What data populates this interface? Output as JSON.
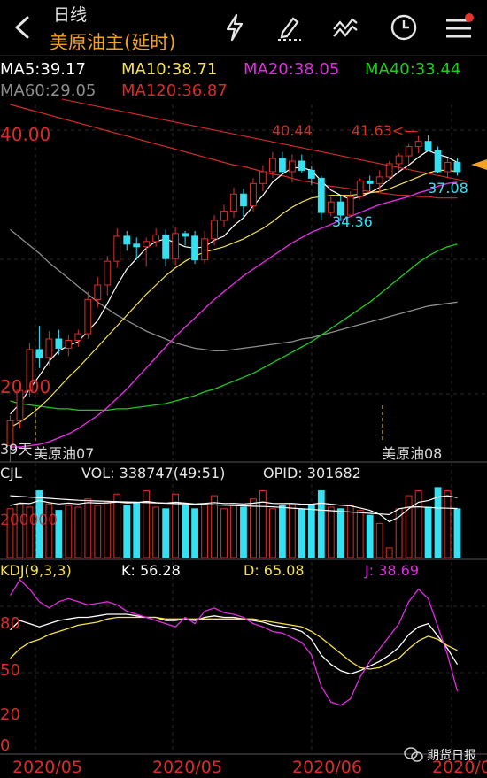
{
  "header": {
    "period": "日线",
    "instrument": "美原油主(延时)",
    "icons": [
      "back-arrow-icon",
      "lightning-icon",
      "pen-draw-icon",
      "indicator-icon",
      "clock-icon",
      "menu-list-icon"
    ]
  },
  "ma_legend": {
    "ma5": "MA5:39.17",
    "ma10": "MA10:38.71",
    "ma20": "MA20:38.05",
    "ma40": "MA40:33.44",
    "ma60": "MA60:29.05",
    "ma120": "MA120:36.87"
  },
  "colors": {
    "up": "#d9302c",
    "down": "#34e1f2",
    "ma5": "#ffffff",
    "ma10": "#f5e14b",
    "ma20": "#e02de0",
    "ma40": "#1ecb1e",
    "ma60": "#8e8e8e",
    "ma120": "#d92b2b",
    "accent": "#f0a126"
  },
  "price_panel": {
    "price_high_label": "40.00",
    "price_low_label": "20.00",
    "high_mark_1": "40.44",
    "high_mark_2": "41.63<—",
    "low_mark": "34.36",
    "recent_low": "37.08",
    "days_label": "39天",
    "contract_1": "美原油07",
    "contract_2": "美原油08"
  },
  "volume_panel": {
    "title": "CJL",
    "vol": "VOL: 338747(49:51)",
    "opid": "OPID: 301682",
    "axis_label": "200000"
  },
  "kdj_panel": {
    "title": "KDJ(9,3,3)",
    "k": "K: 56.28",
    "d": "D: 65.08",
    "j": "J: 38.69",
    "ticks": [
      "80",
      "50",
      "20",
      "0"
    ]
  },
  "x_axis": [
    "2020/05",
    "2020/05",
    "2020/06",
    "2020/0"
  ],
  "watermark": "期货日报",
  "chart_data": [
    {
      "type": "candlestick",
      "title": "美原油主(延时)",
      "ylim": [
        17,
        44
      ],
      "candles": [
        [
          18.1,
          20.4,
          16.9,
          20.0
        ],
        [
          20.0,
          22.8,
          19.4,
          22.3
        ],
        [
          22.3,
          25.9,
          21.8,
          25.4
        ],
        [
          25.4,
          27.2,
          24.0,
          24.8
        ],
        [
          24.8,
          26.8,
          24.2,
          26.2
        ],
        [
          26.2,
          26.9,
          25.0,
          25.5
        ],
        [
          25.5,
          26.5,
          24.9,
          26.1
        ],
        [
          26.1,
          26.9,
          25.6,
          26.6
        ],
        [
          26.6,
          29.8,
          26.2,
          29.2
        ],
        [
          29.2,
          30.9,
          28.6,
          30.3
        ],
        [
          30.3,
          32.5,
          29.5,
          32.1
        ],
        [
          32.1,
          34.6,
          31.6,
          34.0
        ],
        [
          34.0,
          34.4,
          32.9,
          33.4
        ],
        [
          33.4,
          33.9,
          32.2,
          33.2
        ],
        [
          33.2,
          33.9,
          31.7,
          33.6
        ],
        [
          33.6,
          34.6,
          33.2,
          34.1
        ],
        [
          34.1,
          34.5,
          31.7,
          32.3
        ],
        [
          32.3,
          34.7,
          31.8,
          34.2
        ],
        [
          34.2,
          34.4,
          33.3,
          34.0
        ],
        [
          34.0,
          34.4,
          31.9,
          32.2
        ],
        [
          32.2,
          34.4,
          31.9,
          33.8
        ],
        [
          33.8,
          35.6,
          33.3,
          35.2
        ],
        [
          35.2,
          36.4,
          34.7,
          35.9
        ],
        [
          35.9,
          37.7,
          35.4,
          37.2
        ],
        [
          37.2,
          37.6,
          35.4,
          36.3
        ],
        [
          36.3,
          38.4,
          35.9,
          38.0
        ],
        [
          38.0,
          39.4,
          37.4,
          38.9
        ],
        [
          38.9,
          40.4,
          38.4,
          39.9
        ],
        [
          39.9,
          40.4,
          38.7,
          38.9
        ],
        [
          38.9,
          40.2,
          38.1,
          39.7
        ],
        [
          39.7,
          40.2,
          38.8,
          39.0
        ],
        [
          39.0,
          39.3,
          37.9,
          38.4
        ],
        [
          38.4,
          38.6,
          35.2,
          35.8
        ],
        [
          35.8,
          37.0,
          35.5,
          36.6
        ],
        [
          36.6,
          37.1,
          35.2,
          35.6
        ],
        [
          35.6,
          37.4,
          35.5,
          37.0
        ],
        [
          37.0,
          38.4,
          36.8,
          38.2
        ],
        [
          38.2,
          38.6,
          37.4,
          38.0
        ],
        [
          38.0,
          39.0,
          37.3,
          38.5
        ],
        [
          38.5,
          39.7,
          38.2,
          39.5
        ],
        [
          39.5,
          40.3,
          39.0,
          40.1
        ],
        [
          40.1,
          41.0,
          39.5,
          40.8
        ],
        [
          40.8,
          41.6,
          40.3,
          41.2
        ],
        [
          41.2,
          41.7,
          40.6,
          40.5
        ],
        [
          40.5,
          40.8,
          38.8,
          38.9
        ],
        [
          38.9,
          39.9,
          38.4,
          39.6
        ],
        [
          39.6,
          39.9,
          38.6,
          38.9
        ]
      ],
      "ma5": [
        20.5,
        21.3,
        22.4,
        23.4,
        24.5,
        25.3,
        25.7,
        26.0,
        26.8,
        27.6,
        28.9,
        30.3,
        31.5,
        32.3,
        33.1,
        33.6,
        33.8,
        33.5,
        33.2,
        33.1,
        33.2,
        33.7,
        34.0,
        34.8,
        35.4,
        36.3,
        37.1,
        38.1,
        38.7,
        39.2,
        39.2,
        39.0,
        38.2,
        37.5,
        37.1,
        36.8,
        37.0,
        37.3,
        37.7,
        38.3,
        38.9,
        39.4,
        40.0,
        40.5,
        40.2,
        40.0,
        39.6
      ],
      "ma10": [
        19.5,
        19.9,
        20.4,
        21.0,
        21.7,
        22.5,
        23.3,
        24.0,
        24.8,
        25.6,
        26.4,
        27.2,
        28.0,
        28.8,
        29.6,
        30.3,
        31.0,
        31.6,
        32.1,
        32.5,
        32.8,
        33.0,
        33.2,
        33.5,
        33.8,
        34.2,
        34.6,
        35.1,
        35.7,
        36.2,
        36.6,
        36.9,
        37.0,
        37.1,
        37.1,
        37.1,
        37.2,
        37.3,
        37.4,
        37.6,
        37.9,
        38.2,
        38.5,
        38.8,
        39.0,
        39.0,
        38.9
      ],
      "ma20": [
        18.0,
        18.0,
        18.1,
        18.2,
        18.4,
        18.7,
        19.0,
        19.4,
        19.9,
        20.4,
        21.0,
        21.7,
        22.4,
        23.2,
        24.0,
        24.8,
        25.6,
        26.4,
        27.1,
        27.8,
        28.5,
        29.2,
        29.8,
        30.4,
        31.0,
        31.5,
        32.0,
        32.5,
        33.0,
        33.5,
        33.9,
        34.3,
        34.6,
        34.9,
        35.2,
        35.5,
        35.8,
        36.1,
        36.4,
        36.6,
        36.8,
        37.0,
        37.3,
        37.5,
        37.8,
        38.0,
        38.1
      ],
      "ma40": [
        21.5,
        21.3,
        21.2,
        21.1,
        21.0,
        20.9,
        20.9,
        20.8,
        20.8,
        20.8,
        20.8,
        20.9,
        20.9,
        21.0,
        21.1,
        21.2,
        21.3,
        21.5,
        21.7,
        21.9,
        22.2,
        22.4,
        22.7,
        23.0,
        23.3,
        23.6,
        24.0,
        24.4,
        24.8,
        25.2,
        25.6,
        26.0,
        26.5,
        27.0,
        27.5,
        28.0,
        28.5,
        29.0,
        29.6,
        30.2,
        30.8,
        31.4,
        32.0,
        32.5,
        32.9,
        33.2,
        33.4
      ],
      "ma60": [
        34.5,
        33.9,
        33.3,
        32.7,
        32.0,
        31.4,
        30.8,
        30.2,
        29.6,
        29.0,
        28.5,
        28.0,
        27.6,
        27.2,
        26.8,
        26.5,
        26.2,
        25.9,
        25.7,
        25.5,
        25.4,
        25.3,
        25.3,
        25.4,
        25.5,
        25.6,
        25.7,
        25.8,
        25.9,
        26.0,
        26.2,
        26.3,
        26.5,
        26.7,
        26.9,
        27.1,
        27.3,
        27.5,
        27.7,
        27.9,
        28.1,
        28.3,
        28.5,
        28.7,
        28.8,
        28.9,
        29.0
      ],
      "ma120": [
        44.0,
        43.8,
        43.6,
        43.4,
        43.2,
        43.0,
        42.8,
        42.6,
        42.4,
        42.2,
        42.0,
        41.8,
        41.6,
        41.4,
        41.2,
        41.0,
        40.8,
        40.6,
        40.4,
        40.2,
        40.0,
        39.8,
        39.6,
        39.4,
        39.3,
        39.1,
        38.9,
        38.7,
        38.6,
        38.4,
        38.2,
        38.1,
        37.9,
        37.8,
        37.7,
        37.6,
        37.5,
        37.4,
        37.3,
        37.2,
        37.1,
        37.1,
        37.0,
        37.0,
        36.9,
        36.9,
        36.9
      ]
    },
    {
      "type": "bar",
      "title": "CJL",
      "ylim": [
        0,
        500000
      ],
      "volumes": [
        300000,
        330000,
        310000,
        410000,
        330000,
        290000,
        320000,
        310000,
        360000,
        320000,
        340000,
        390000,
        320000,
        340000,
        410000,
        310000,
        300000,
        390000,
        320000,
        300000,
        330000,
        380000,
        300000,
        320000,
        310000,
        360000,
        410000,
        300000,
        320000,
        330000,
        300000,
        320000,
        410000,
        310000,
        300000,
        320000,
        290000,
        260000,
        210000,
        60000,
        300000,
        380000,
        410000,
        310000,
        430000,
        410000,
        300000
      ],
      "vol_line": [
        320000,
        335000,
        332000,
        350000,
        338000,
        330000,
        335000,
        330000,
        338000,
        335000,
        336000,
        342000,
        336000,
        338000,
        345000,
        338000,
        334000,
        340000,
        335000,
        330000,
        333000,
        338000,
        332000,
        333000,
        330000,
        334000,
        342000,
        333000,
        332000,
        333000,
        328000,
        328000,
        335000,
        328000,
        322000,
        318000,
        305000,
        290000,
        265000,
        220000,
        250000,
        300000,
        340000,
        350000,
        372000,
        380000,
        368000
      ],
      "opid_line": [
        380000,
        376000,
        372000,
        368000,
        364000,
        360000,
        356000,
        352000,
        350000,
        348000,
        346000,
        344000,
        342000,
        340000,
        338000,
        336000,
        334000,
        332000,
        330000,
        328000,
        326000,
        324000,
        322000,
        320000,
        318000,
        316000,
        314000,
        312000,
        308000,
        304000,
        300000,
        296000,
        292000,
        288000,
        284000,
        280000,
        276000,
        272000,
        268000,
        264000,
        300000,
        310000,
        312000,
        308000,
        305000,
        303000,
        301682
      ]
    },
    {
      "type": "line",
      "title": "KDJ(9,3,3)",
      "ylim": [
        0,
        110
      ],
      "series": [
        {
          "name": "K",
          "values": [
            78,
            84,
            82,
            80,
            82,
            84,
            85,
            86,
            86,
            87,
            88,
            88,
            88,
            87,
            86,
            86,
            84,
            84,
            85,
            84,
            86,
            87,
            86,
            86,
            85,
            84,
            83,
            81,
            80,
            79,
            77,
            72,
            62,
            56,
            52,
            50,
            52,
            55,
            58,
            62,
            67,
            75,
            80,
            82,
            74,
            66,
            56
          ]
        },
        {
          "name": "D",
          "values": [
            60,
            66,
            70,
            72,
            75,
            77,
            79,
            81,
            82,
            83,
            85,
            86,
            86,
            86,
            86,
            86,
            85,
            85,
            85,
            85,
            85,
            85,
            85,
            85,
            85,
            85,
            84,
            83,
            82,
            81,
            80,
            77,
            73,
            68,
            63,
            58,
            54,
            53,
            54,
            57,
            60,
            66,
            71,
            74,
            72,
            68,
            65
          ]
        },
        {
          "name": "J",
          "values": [
            100,
            110,
            104,
            96,
            92,
            96,
            98,
            96,
            94,
            95,
            96,
            94,
            90,
            88,
            86,
            84,
            82,
            80,
            86,
            82,
            90,
            92,
            89,
            88,
            86,
            82,
            80,
            77,
            76,
            73,
            70,
            62,
            42,
            32,
            30,
            34,
            48,
            58,
            66,
            74,
            82,
            96,
            104,
            98,
            80,
            62,
            39
          ]
        }
      ]
    }
  ]
}
